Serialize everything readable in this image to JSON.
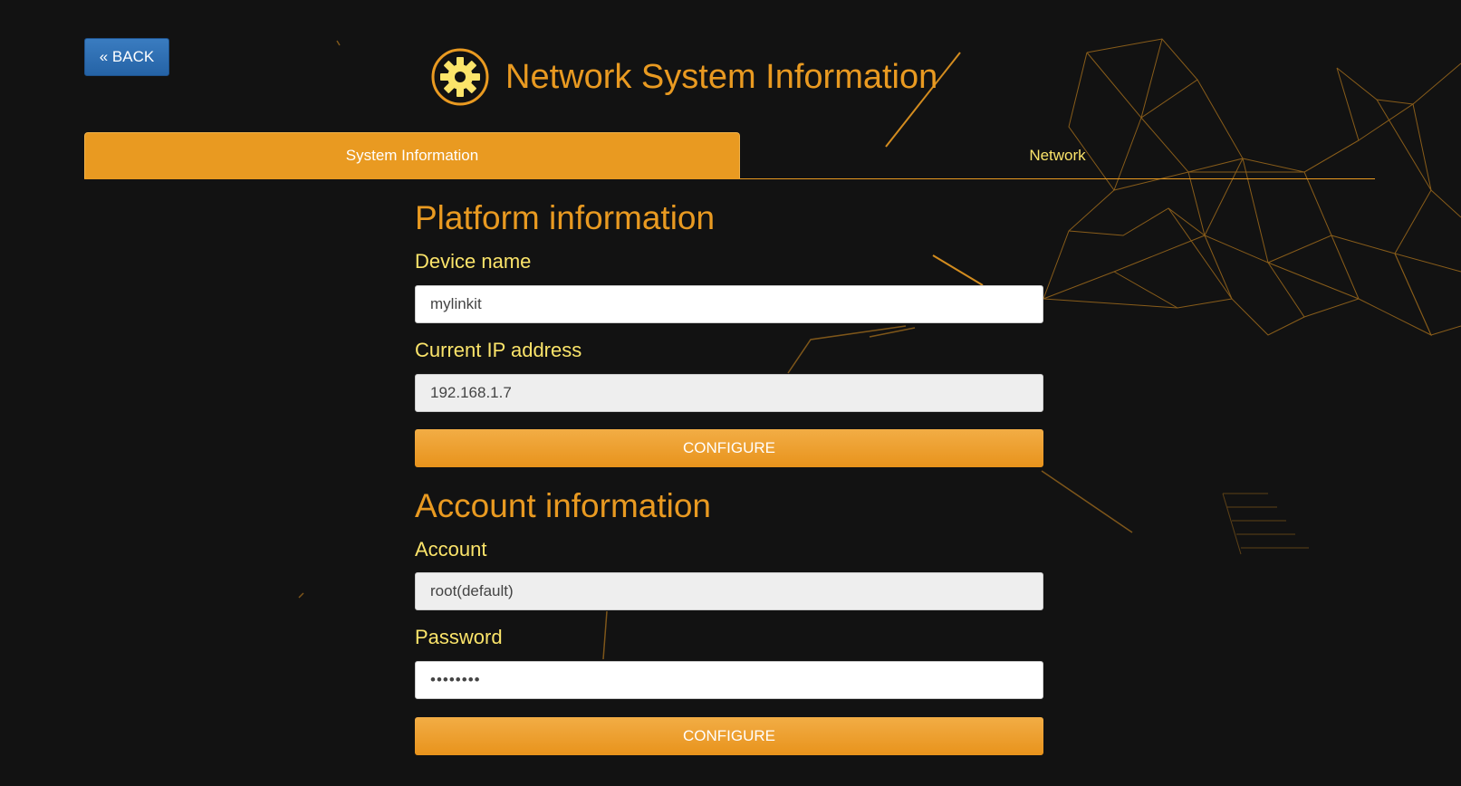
{
  "colors": {
    "background": "#121212",
    "accent": "#e99a21",
    "label_yellow": "#fbe46a",
    "back_button_blue": "#2e70b5"
  },
  "header": {
    "back_label": "« BACK",
    "icon": "gear-icon",
    "title": "Network System Information"
  },
  "tabs": [
    {
      "label": "System Information",
      "active": true
    },
    {
      "label": "Network",
      "active": false
    }
  ],
  "platform": {
    "title": "Platform information",
    "device_name_label": "Device name",
    "device_name_value": "mylinkit",
    "ip_label": "Current IP address",
    "ip_value": "192.168.1.7",
    "configure_label": "CONFIGURE"
  },
  "account": {
    "title": "Account information",
    "account_label": "Account",
    "account_value": "root(default)",
    "password_label": "Password",
    "password_value": "••••••••",
    "configure_label": "CONFIGURE"
  }
}
